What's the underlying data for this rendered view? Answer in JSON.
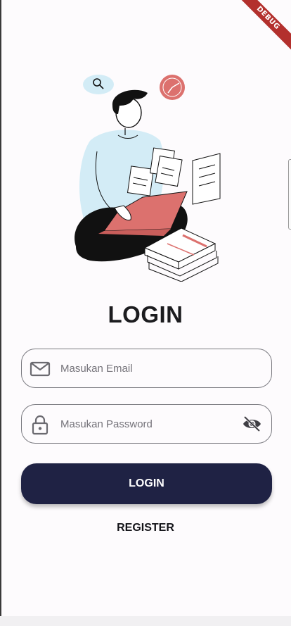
{
  "debug_banner": {
    "label": "DEBUG"
  },
  "login": {
    "title": "LOGIN",
    "email_placeholder": "Masukan Email",
    "password_placeholder": "Masukan Password",
    "login_button": "LOGIN",
    "register_link": "REGISTER"
  },
  "icons": {
    "email": "mail-icon",
    "password": "lock-icon",
    "visibility": "eye-off-icon"
  },
  "colors": {
    "primary_button": "#1f2244",
    "accent_illustration": "#dc716e",
    "illustration_sweater": "#d3ecf6",
    "debug_ribbon": "#b3302d"
  }
}
